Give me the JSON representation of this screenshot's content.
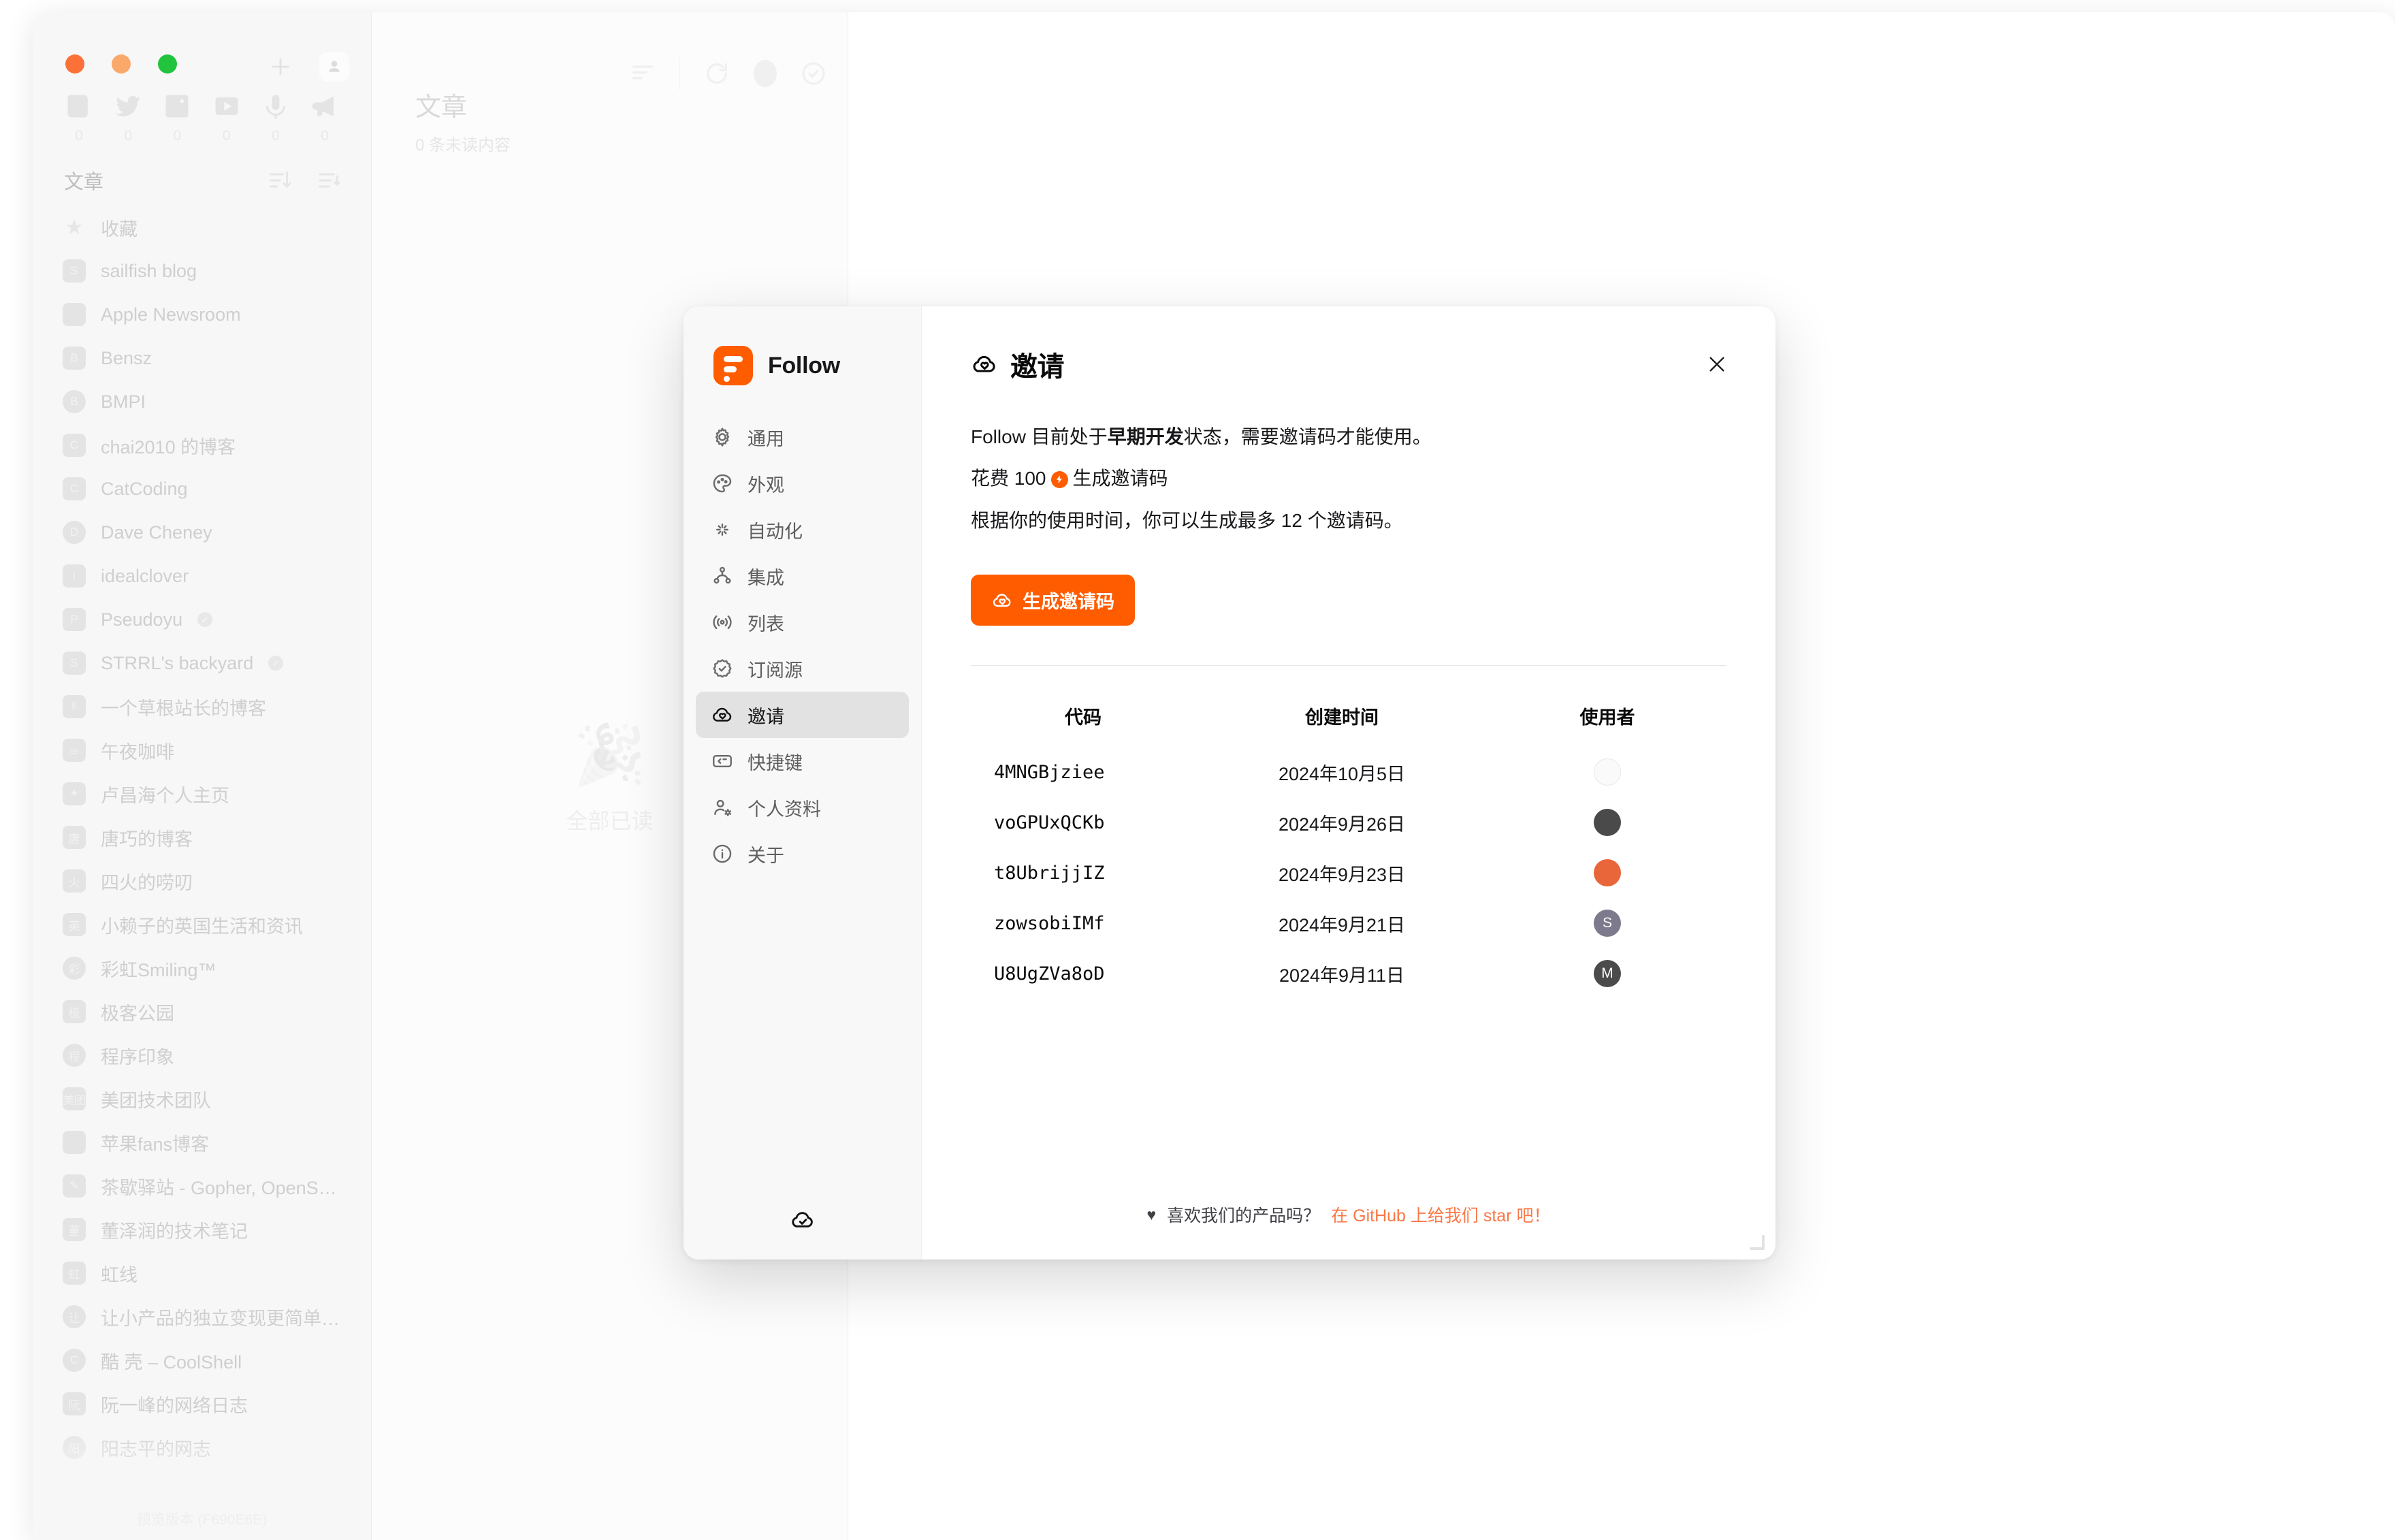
{
  "window": {
    "traffic_lights": [
      "close",
      "minimize",
      "maximize"
    ]
  },
  "feed_sidebar": {
    "title": "文章",
    "version": "预览版本 (F690E6E)",
    "view_tabs": [
      {
        "icon": "article-icon",
        "count": "0"
      },
      {
        "icon": "twitter-icon",
        "count": "0"
      },
      {
        "icon": "picture-icon",
        "count": "0"
      },
      {
        "icon": "video-icon",
        "count": "0"
      },
      {
        "icon": "microphone-icon",
        "count": "0"
      },
      {
        "icon": "megaphone-icon",
        "count": "0"
      }
    ],
    "items": [
      {
        "name": "收藏",
        "avatar": "★",
        "star": true
      },
      {
        "name": "sailfish blog",
        "avatar": "S"
      },
      {
        "name": "Apple Newsroom",
        "avatar": ""
      },
      {
        "name": "Bensz",
        "avatar": "B"
      },
      {
        "name": "BMPI",
        "avatar": "B",
        "round": true
      },
      {
        "name": "chai2010 的博客",
        "avatar": "C"
      },
      {
        "name": "CatCoding",
        "avatar": "C"
      },
      {
        "name": "Dave Cheney",
        "avatar": "D",
        "round": true
      },
      {
        "name": "idealclover",
        "avatar": "i"
      },
      {
        "name": "Pseudoyu",
        "avatar": "P",
        "verified": true
      },
      {
        "name": "STRRL's backyard",
        "avatar": "S",
        "verified": true
      },
      {
        "name": "一个草根站长的博客",
        "avatar": "✌"
      },
      {
        "name": "午夜咖啡",
        "avatar": "☕"
      },
      {
        "name": "卢昌海个人主页",
        "avatar": "✦"
      },
      {
        "name": "唐巧的博客",
        "avatar": "唐"
      },
      {
        "name": "四火的唠叨",
        "avatar": "火"
      },
      {
        "name": "小赖子的英国生活和资讯",
        "avatar": "英"
      },
      {
        "name": "彩虹Smiling™",
        "avatar": "彩",
        "round": true
      },
      {
        "name": "极客公园",
        "avatar": "极"
      },
      {
        "name": "程序印象",
        "avatar": "程",
        "round": true
      },
      {
        "name": "美团技术团队",
        "avatar": "美团"
      },
      {
        "name": "苹果fans博客",
        "avatar": ""
      },
      {
        "name": "茶歇驿站 - Gopher, OpenSo...",
        "avatar": "✎"
      },
      {
        "name": "董泽润的技术笔记",
        "avatar": "董"
      },
      {
        "name": "虹线",
        "avatar": "虹"
      },
      {
        "name": "让小产品的独立变现更简单 -...",
        "avatar": "让",
        "round": true
      },
      {
        "name": "酷 壳 – CoolShell",
        "avatar": "C",
        "round": true
      },
      {
        "name": "阮一峰的网络日志",
        "avatar": "阮"
      },
      {
        "name": "阳志平的网志",
        "avatar": "阳",
        "round": true
      }
    ]
  },
  "entry_column": {
    "title": "文章",
    "subtitle": "0 条未读内容",
    "empty_icon": "🎉",
    "empty_text": "全部已读",
    "toolbar_icons": [
      "filter-icon",
      "refresh-icon",
      "unread-dot-icon",
      "mark-all-read-icon"
    ]
  },
  "settings_modal": {
    "brand": "Follow",
    "nav": [
      {
        "label": "通用",
        "icon": "gear-icon"
      },
      {
        "label": "外观",
        "icon": "palette-icon"
      },
      {
        "label": "自动化",
        "icon": "sparkles-icon"
      },
      {
        "label": "集成",
        "icon": "nodes-icon"
      },
      {
        "label": "列表",
        "icon": "broadcast-icon"
      },
      {
        "label": "订阅源",
        "icon": "badge-check-icon"
      },
      {
        "label": "邀请",
        "icon": "cloud-heart-icon",
        "active": true
      },
      {
        "label": "快捷键",
        "icon": "keyboard-icon"
      },
      {
        "label": "个人资料",
        "icon": "user-cog-icon"
      },
      {
        "label": "关于",
        "icon": "info-icon"
      }
    ],
    "sync_icon": "cloud-check-icon",
    "title": "邀请",
    "title_icon": "cloud-heart-icon",
    "close_icon": "close-icon",
    "description": {
      "line1_pre": "Follow 目前处于",
      "line1_bold": "早期开发",
      "line1_post": "状态，需要邀请码才能使用。",
      "line2_pre": "花费 100",
      "line2_post": "生成邀请码",
      "line3": "根据你的使用时间，你可以生成最多 12 个邀请码。"
    },
    "generate_button": "生成邀请码",
    "table": {
      "headers": {
        "code": "代码",
        "created": "创建时间",
        "user": "使用者"
      },
      "rows": [
        {
          "code": "4MNGBjziee",
          "created": "2024年10月5日",
          "user_initial": "",
          "user_color": "#fafafa",
          "user_text": "#bdbdbd",
          "user_border": true
        },
        {
          "code": "voGPUxQCKb",
          "created": "2024年9月26日",
          "user_initial": "",
          "user_color": "#4a4a4a",
          "user_text": "#ffffff"
        },
        {
          "code": "t8UbrijjIZ",
          "created": "2024年9月23日",
          "user_initial": "",
          "user_color": "#e8663a",
          "user_text": "#ffffff"
        },
        {
          "code": "zowsobiIMf",
          "created": "2024年9月21日",
          "user_initial": "S",
          "user_color": "#7c7a8c",
          "user_text": "#ffffff"
        },
        {
          "code": "U8UgZVa8oD",
          "created": "2024年9月11日",
          "user_initial": "M",
          "user_color": "#4b4b4b",
          "user_text": "#ffffff"
        }
      ]
    },
    "footer": {
      "heart": "♥",
      "question": "喜欢我们的产品吗？",
      "link": "在 GitHub 上给我们 star 吧！"
    }
  },
  "colors": {
    "brand_orange": "#ff5c00",
    "link_orange": "#f97847",
    "active_nav_bg": "#e2e2e2"
  }
}
